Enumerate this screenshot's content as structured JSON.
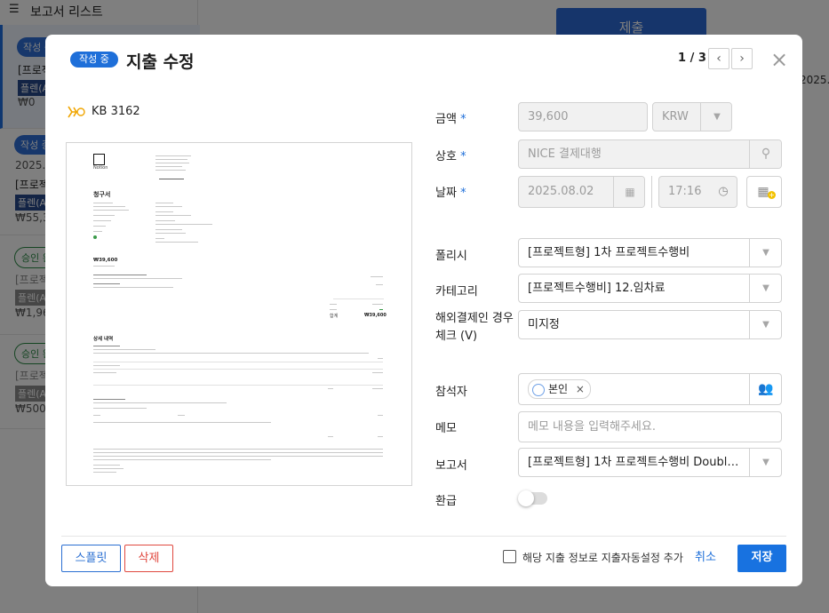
{
  "background": {
    "list_title": "보고서 리스트",
    "submit_label": "제출",
    "cards": [
      {
        "badge": "작성 중",
        "lines": [
          "[프로젝",
          "",
          "₩0"
        ],
        "tag": "플렌(Al"
      },
      {
        "badge": "작성 중",
        "lines": [
          "2025.0",
          "[프로젝",
          "₩55,3"
        ],
        "tag": "플렌(Al"
      },
      {
        "badge": "승인 완",
        "lines": [
          "[프로젝",
          "₩1,96"
        ],
        "tag": "플렌(Al"
      },
      {
        "badge": "승인 완",
        "lines": [
          "[프로젝",
          "₩500,"
        ],
        "tag": "플렌(Al"
      }
    ],
    "right_fragment": "2025.0"
  },
  "modal": {
    "status": "작성 중",
    "title": "지출 수정",
    "pager": "1 / 3",
    "card_name": "KB 3162"
  },
  "receipt": {
    "logo_text": "Notion",
    "heading": "청구서",
    "amount": "₩39,600",
    "total_label": "합계",
    "total": "₩39,600",
    "detail_heading": "상세 내역"
  },
  "form": {
    "amount_label": "금액",
    "amount_value": "39,600",
    "currency": "KRW",
    "merchant_label": "상호",
    "merchant_value": "NICE 결제대행",
    "date_label": "날짜",
    "date_value": "2025.08.02",
    "time_value": "17:16",
    "policy_label": "폴리시",
    "policy_value": "[프로젝트형] 1차 프로젝트수행비",
    "category_label": "카테고리",
    "category_value": "[프로젝트수행비] 12.임차료",
    "overseas_label_1": "해외결제인 경우",
    "overseas_label_2": "체크 (V)",
    "overseas_value": "미지정",
    "attendee_label": "참석자",
    "attendee_chip": "본인",
    "memo_label": "메모",
    "memo_placeholder": "메모 내용을 입력해주세요.",
    "report_label": "보고서",
    "report_value": "[프로젝트형] 1차 프로젝트수행비 Doubl…",
    "refund_label": "환급",
    "refund_on": false
  },
  "footer": {
    "split": "스플릿",
    "delete": "삭제",
    "auto_setting": "해당 지출 정보로 지출자동설정 추가",
    "cancel": "취소",
    "save": "저장"
  },
  "colors": {
    "primary": "#1872e0",
    "danger": "#e0483f",
    "required": "#1e6fd9"
  }
}
